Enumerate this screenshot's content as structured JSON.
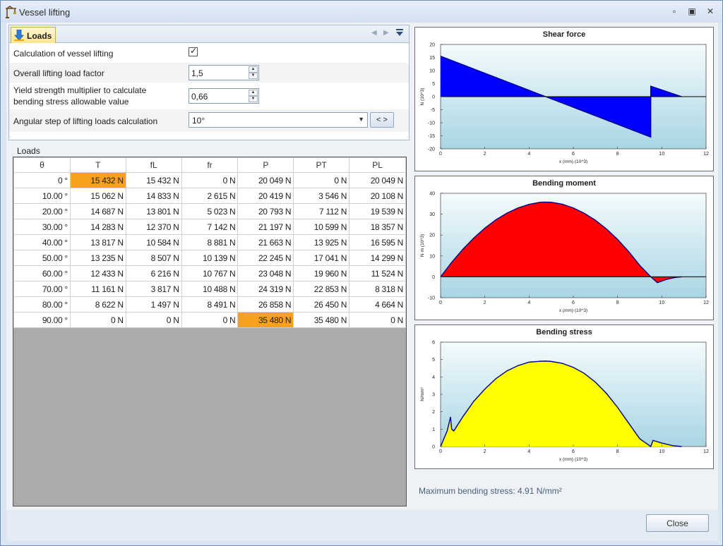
{
  "window": {
    "title": "Vessel lifting",
    "minimize_glyph": "▫",
    "restore_glyph": "▣",
    "close_glyph": "✕",
    "icon": "crane-icon"
  },
  "tab": {
    "label": "Loads",
    "icon": "down-arrow-icon",
    "nav_prev": "◀",
    "nav_next": "▶"
  },
  "properties": {
    "calc_label": "Calculation of vessel lifting",
    "calc_checked": "✓",
    "factor_label": "Overall lifting load factor",
    "factor_value": "1,5",
    "yield_label_line1": "Yield strength multiplier to calculate",
    "yield_label_line2": "bending stress allowable value",
    "yield_value": "0,66",
    "angular_label": "Angular step of lifting loads calculation",
    "angular_value": "10°",
    "nav_label": "<  >"
  },
  "loads": {
    "label": "Loads",
    "columns": [
      "θ",
      "T",
      "fL",
      "fr",
      "P",
      "PT",
      "PL"
    ],
    "rows": [
      [
        "0 °",
        "15 432 N",
        "15 432 N",
        "0 N",
        "20 049 N",
        "0 N",
        "20 049 N"
      ],
      [
        "10.00 °",
        "15 062 N",
        "14 833 N",
        "2 615 N",
        "20 419 N",
        "3 546 N",
        "20 108 N"
      ],
      [
        "20.00 °",
        "14 687 N",
        "13 801 N",
        "5 023 N",
        "20 793 N",
        "7 112 N",
        "19 539 N"
      ],
      [
        "30.00 °",
        "14 283 N",
        "12 370 N",
        "7 142 N",
        "21 197 N",
        "10 599 N",
        "18 357 N"
      ],
      [
        "40.00 °",
        "13 817 N",
        "10 584 N",
        "8 881 N",
        "21 663 N",
        "13 925 N",
        "16 595 N"
      ],
      [
        "50.00 °",
        "13 235 N",
        "8 507 N",
        "10 139 N",
        "22 245 N",
        "17 041 N",
        "14 299 N"
      ],
      [
        "60.00 °",
        "12 433 N",
        "6 216 N",
        "10 767 N",
        "23 048 N",
        "19 960 N",
        "11 524 N"
      ],
      [
        "70.00 °",
        "11 161 N",
        "3 817 N",
        "10 488 N",
        "24 319 N",
        "22 853 N",
        "8 318 N"
      ],
      [
        "80.00 °",
        "8 622 N",
        "1 497 N",
        "8 491 N",
        "26 858 N",
        "26 450 N",
        "4 664 N"
      ],
      [
        "90.00 °",
        "0 N",
        "0 N",
        "0 N",
        "35 480 N",
        "35 480 N",
        "0 N"
      ]
    ],
    "highlights": [
      [
        0,
        1
      ],
      [
        9,
        4
      ]
    ],
    "highlight_color": "#f7a11e"
  },
  "max_stress": "Maximum bending stress: 4.91 N/mm²",
  "close_label": "Close",
  "chart_data": [
    {
      "type": "area",
      "title": "Shear force",
      "xlabel": "x (mm) (10^3)",
      "ylabel": "N (10^3)",
      "xlim": [
        0,
        12
      ],
      "ylim": [
        -20,
        20
      ],
      "xticks": [
        0,
        2,
        4,
        6,
        8,
        10,
        12
      ],
      "yticks": [
        -20,
        -15,
        -10,
        -5,
        0,
        5,
        10,
        15,
        20
      ],
      "fill": "#0000ff",
      "x": [
        0,
        4.75,
        9.5,
        9.5,
        10.9
      ],
      "y": [
        15.5,
        0,
        -15.5,
        4,
        0
      ]
    },
    {
      "type": "area",
      "title": "Bending moment",
      "xlabel": "x (mm) (10^3)",
      "ylabel": "N·m (10^3)",
      "xlim": [
        0,
        12
      ],
      "ylim": [
        -10,
        40
      ],
      "xticks": [
        0,
        2,
        4,
        6,
        8,
        10,
        12
      ],
      "yticks": [
        -10,
        0,
        10,
        20,
        30,
        40
      ],
      "fill": "#ff0000",
      "x": [
        0,
        0.5,
        1,
        1.5,
        2,
        2.5,
        3,
        3.5,
        4,
        4.5,
        4.75,
        5,
        5.5,
        6,
        6.5,
        7,
        7.5,
        8,
        8.5,
        9,
        9.5,
        9.8,
        10.2,
        10.6,
        10.9
      ],
      "y": [
        0,
        6.9,
        13.1,
        18.6,
        23.3,
        27.3,
        30.5,
        33.0,
        34.7,
        35.7,
        35.8,
        35.7,
        34.8,
        33.0,
        30.4,
        27.1,
        22.9,
        17.9,
        12.1,
        5.5,
        0,
        -2.8,
        -1.3,
        -0.3,
        0
      ]
    },
    {
      "type": "area",
      "title": "Bending stress",
      "xlabel": "x (mm) (10^3)",
      "ylabel": "N/mm²",
      "xlim": [
        0,
        12
      ],
      "ylim": [
        0,
        6
      ],
      "xticks": [
        0,
        2,
        4,
        6,
        8,
        10,
        12
      ],
      "yticks": [
        0,
        1,
        2,
        3,
        4,
        5,
        6
      ],
      "fill": "#ffff00",
      "x": [
        0,
        0.3,
        0.45,
        0.5,
        0.6,
        1,
        1.5,
        2,
        2.5,
        3,
        3.5,
        4,
        4.5,
        4.75,
        5,
        5.5,
        6,
        6.5,
        7,
        7.5,
        8,
        8.5,
        9,
        9.5,
        9.6,
        10,
        10.5,
        10.9
      ],
      "y": [
        0,
        0.9,
        1.7,
        1.0,
        0.9,
        1.7,
        2.6,
        3.3,
        3.9,
        4.35,
        4.65,
        4.85,
        4.9,
        4.91,
        4.89,
        4.78,
        4.55,
        4.2,
        3.7,
        3.05,
        2.25,
        1.35,
        0.45,
        0,
        0.35,
        0.2,
        0.05,
        0
      ]
    }
  ]
}
